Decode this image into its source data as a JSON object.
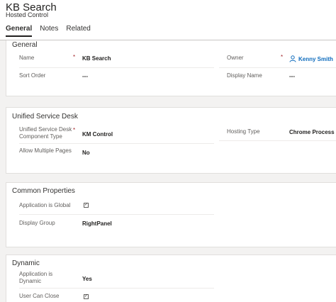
{
  "header": {
    "title": "KB Search",
    "subtitle": "Hosted Control",
    "tabs": [
      {
        "label": "General"
      },
      {
        "label": "Notes"
      },
      {
        "label": "Related"
      }
    ]
  },
  "general": {
    "title": "General",
    "name_label": "Name",
    "name_value": "KB Search",
    "sort_label": "Sort Order",
    "sort_value": "---",
    "owner_label": "Owner",
    "owner_value": "Kenny Smith",
    "display_name_label": "Display Name",
    "display_name_value": "---"
  },
  "usd": {
    "title": "Unified Service Desk",
    "component_label": "Unified Service Desk Component Type",
    "component_value": "KM Control",
    "allow_label": "Allow Multiple Pages",
    "allow_value": "No",
    "hosting_label": "Hosting Type",
    "hosting_value": "Chrome Process"
  },
  "common": {
    "title": "Common Properties",
    "global_label": "Application is Global",
    "display_group_label": "Display Group",
    "display_group_value": "RightPanel"
  },
  "dynamic": {
    "title": "Dynamic",
    "dynamic_label": "Application is Dynamic",
    "dynamic_value": "Yes",
    "close_label": "User Can Close"
  },
  "required_mark": "*",
  "check_mark": "✓",
  "colors": {
    "link": "#0f6cbd",
    "required": "#a4262c",
    "background": "#f3f2f1"
  }
}
